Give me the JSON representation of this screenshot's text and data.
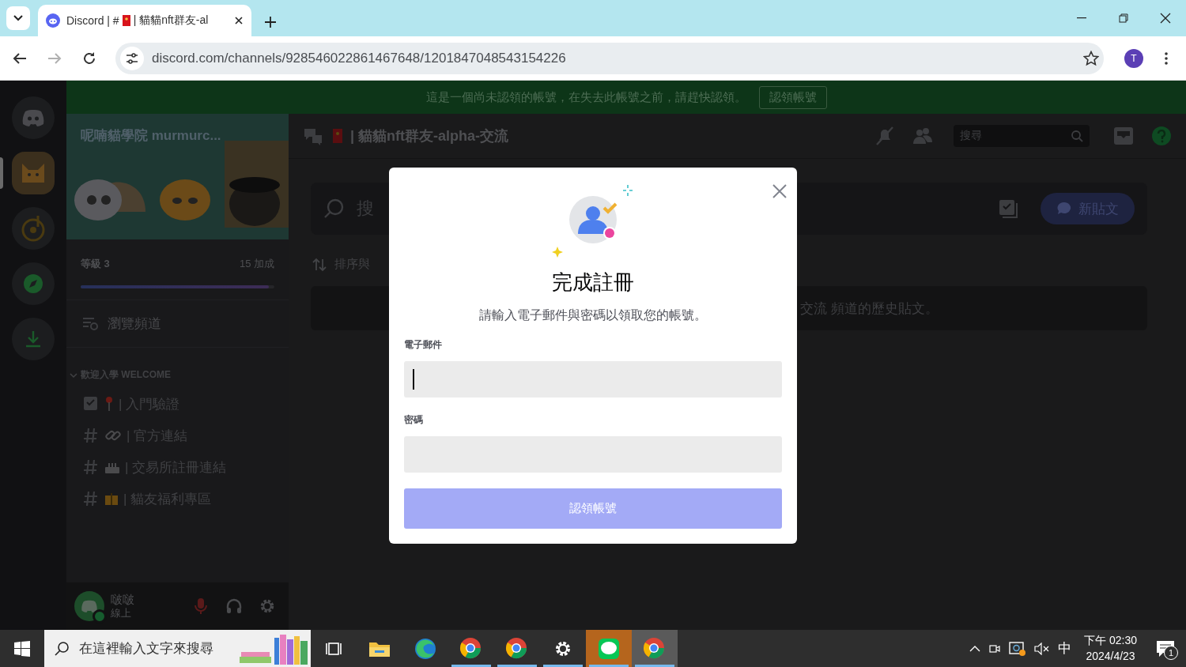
{
  "browser": {
    "tab": {
      "title_parts": [
        "Discord | #",
        "| 貓貓nft群友-al"
      ],
      "selected": true
    },
    "back_enabled": true,
    "forward_enabled": false,
    "address": "discord.com/channels/928546022861467648/1201847048543154226",
    "profile": "T"
  },
  "servers": [
    {
      "selected": true
    },
    {
      "selected": false
    },
    {
      "selected": false
    }
  ],
  "banner": {
    "text": "這是一個尚未認領的帳號，在失去此帳號之前，請趕快認領。",
    "button": "認領帳號"
  },
  "server": {
    "name": "呢喃貓學院 murmurc..."
  },
  "boost": {
    "level_label": "等級 3",
    "boosts": "15 加成",
    "level": 0.97
  },
  "browse": "瀏覽頻道",
  "category": {
    "name": "歡迎入學 WELCOME",
    "expanded": true
  },
  "channels": [
    {
      "kind": "forum",
      "name": "| 入門驗證"
    },
    {
      "kind": "text",
      "name": "| 官方連結"
    },
    {
      "kind": "text",
      "name": "| 交易所註冊連結"
    },
    {
      "kind": "text",
      "name": "| 貓友福利專區"
    }
  ],
  "user": {
    "name": "啵啵",
    "status": "線上",
    "mic_muted": true
  },
  "channel_header": {
    "name": "| 貓貓nft群友-alpha-交流",
    "search_placeholder": "搜尋"
  },
  "forum": {
    "search_placeholder": "搜",
    "new_post": "新貼文",
    "sort": "排序與",
    "notice": "交流 頻道的歷史貼文。"
  },
  "modal": {
    "title": "完成註冊",
    "subtitle": "請輸入電子郵件與密碼以領取您的帳號。",
    "fields": [
      {
        "label": "電子郵件",
        "focused": true
      },
      {
        "label": "密碼",
        "focused": false
      }
    ],
    "submit": {
      "label": "認領帳號",
      "disabled": true
    }
  },
  "taskbar": {
    "search_placeholder": "在這裡輸入文字來搜尋",
    "apps": [
      {
        "kind": "task-view",
        "running": false,
        "attention": false,
        "active": false
      },
      {
        "kind": "explorer",
        "running": false,
        "attention": false,
        "active": false
      },
      {
        "kind": "edge",
        "running": false,
        "attention": false,
        "active": false
      },
      {
        "kind": "chrome",
        "running": true,
        "attention": false,
        "active": false
      },
      {
        "kind": "chrome",
        "running": true,
        "attention": false,
        "active": false
      },
      {
        "kind": "settings",
        "running": true,
        "attention": false,
        "active": false
      },
      {
        "kind": "line",
        "running": true,
        "attention": true,
        "active": false
      },
      {
        "kind": "chrome",
        "running": true,
        "attention": false,
        "active": true
      }
    ],
    "ime": "中",
    "time": "下午 02:30",
    "date": "2024/4/23",
    "notifications": "1"
  }
}
